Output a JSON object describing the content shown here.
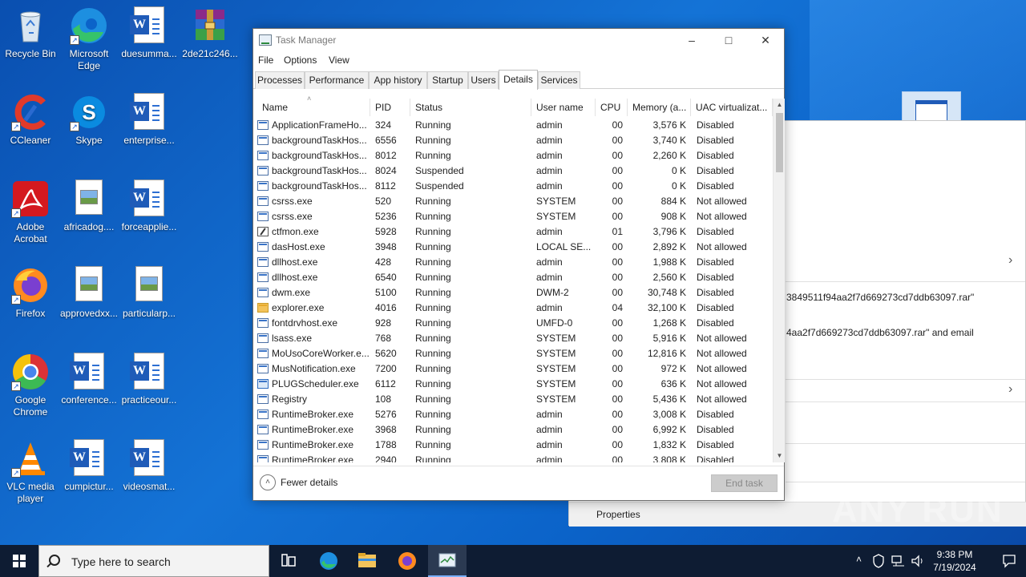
{
  "desktop": {
    "icons": [
      {
        "label": "Recycle Bin",
        "icon": "recycle-bin-icon"
      },
      {
        "label": "Microsoft Edge",
        "icon": "edge-icon"
      },
      {
        "label": "duesumma...",
        "icon": "word-doc-icon"
      },
      {
        "label": "2de21c246...",
        "icon": "winrar-archive-icon"
      },
      {
        "label": "CCleaner",
        "icon": "ccleaner-icon"
      },
      {
        "label": "Skype",
        "icon": "skype-icon"
      },
      {
        "label": "enterprise...",
        "icon": "word-doc-icon"
      },
      {
        "label": "Adobe Acrobat",
        "icon": "acrobat-icon"
      },
      {
        "label": "africadog....",
        "icon": "image-file-icon"
      },
      {
        "label": "forceapplie...",
        "icon": "word-doc-icon"
      },
      {
        "label": "Firefox",
        "icon": "firefox-icon"
      },
      {
        "label": "approvedxx...",
        "icon": "image-file-icon"
      },
      {
        "label": "particularp...",
        "icon": "image-file-icon"
      },
      {
        "label": "Google Chrome",
        "icon": "chrome-icon"
      },
      {
        "label": "conference...",
        "icon": "word-doc-icon"
      },
      {
        "label": "practiceour...",
        "icon": "word-doc-icon"
      },
      {
        "label": "VLC media player",
        "icon": "vlc-icon"
      },
      {
        "label": "cumpictur...",
        "icon": "word-doc-icon"
      },
      {
        "label": "videosmat...",
        "icon": "word-doc-icon"
      }
    ]
  },
  "task_manager": {
    "title": "Task Manager",
    "menu": [
      "File",
      "Options",
      "View"
    ],
    "tabs": [
      "Processes",
      "Performance",
      "App history",
      "Startup",
      "Users",
      "Details",
      "Services"
    ],
    "active_tab": "Details",
    "columns": [
      "Name",
      "PID",
      "Status",
      "User name",
      "CPU",
      "Memory (a...",
      "UAC virtualizat..."
    ],
    "rows": [
      {
        "name": "ApplicationFrameHo...",
        "pid": "324",
        "status": "Running",
        "user": "admin",
        "cpu": "00",
        "mem": "3,576 K",
        "uac": "Disabled",
        "icon": "app"
      },
      {
        "name": "backgroundTaskHos...",
        "pid": "6556",
        "status": "Running",
        "user": "admin",
        "cpu": "00",
        "mem": "3,740 K",
        "uac": "Disabled",
        "icon": "app"
      },
      {
        "name": "backgroundTaskHos...",
        "pid": "8012",
        "status": "Running",
        "user": "admin",
        "cpu": "00",
        "mem": "2,260 K",
        "uac": "Disabled",
        "icon": "app"
      },
      {
        "name": "backgroundTaskHos...",
        "pid": "8024",
        "status": "Suspended",
        "user": "admin",
        "cpu": "00",
        "mem": "0 K",
        "uac": "Disabled",
        "icon": "app"
      },
      {
        "name": "backgroundTaskHos...",
        "pid": "8112",
        "status": "Suspended",
        "user": "admin",
        "cpu": "00",
        "mem": "0 K",
        "uac": "Disabled",
        "icon": "app"
      },
      {
        "name": "csrss.exe",
        "pid": "520",
        "status": "Running",
        "user": "SYSTEM",
        "cpu": "00",
        "mem": "884 K",
        "uac": "Not allowed",
        "icon": "app"
      },
      {
        "name": "csrss.exe",
        "pid": "5236",
        "status": "Running",
        "user": "SYSTEM",
        "cpu": "00",
        "mem": "908 K",
        "uac": "Not allowed",
        "icon": "app"
      },
      {
        "name": "ctfmon.exe",
        "pid": "5928",
        "status": "Running",
        "user": "admin",
        "cpu": "01",
        "mem": "3,796 K",
        "uac": "Disabled",
        "icon": "pen"
      },
      {
        "name": "dasHost.exe",
        "pid": "3948",
        "status": "Running",
        "user": "LOCAL SE...",
        "cpu": "00",
        "mem": "2,892 K",
        "uac": "Not allowed",
        "icon": "app"
      },
      {
        "name": "dllhost.exe",
        "pid": "428",
        "status": "Running",
        "user": "admin",
        "cpu": "00",
        "mem": "1,988 K",
        "uac": "Disabled",
        "icon": "app"
      },
      {
        "name": "dllhost.exe",
        "pid": "6540",
        "status": "Running",
        "user": "admin",
        "cpu": "00",
        "mem": "2,560 K",
        "uac": "Disabled",
        "icon": "app"
      },
      {
        "name": "dwm.exe",
        "pid": "5100",
        "status": "Running",
        "user": "DWM-2",
        "cpu": "00",
        "mem": "30,748 K",
        "uac": "Disabled",
        "icon": "app"
      },
      {
        "name": "explorer.exe",
        "pid": "4016",
        "status": "Running",
        "user": "admin",
        "cpu": "04",
        "mem": "32,100 K",
        "uac": "Disabled",
        "icon": "folder"
      },
      {
        "name": "fontdrvhost.exe",
        "pid": "928",
        "status": "Running",
        "user": "UMFD-0",
        "cpu": "00",
        "mem": "1,268 K",
        "uac": "Disabled",
        "icon": "app"
      },
      {
        "name": "lsass.exe",
        "pid": "768",
        "status": "Running",
        "user": "SYSTEM",
        "cpu": "00",
        "mem": "5,916 K",
        "uac": "Not allowed",
        "icon": "app"
      },
      {
        "name": "MoUsoCoreWorker.e...",
        "pid": "5620",
        "status": "Running",
        "user": "SYSTEM",
        "cpu": "00",
        "mem": "12,816 K",
        "uac": "Not allowed",
        "icon": "app"
      },
      {
        "name": "MusNotification.exe",
        "pid": "7200",
        "status": "Running",
        "user": "SYSTEM",
        "cpu": "00",
        "mem": "972 K",
        "uac": "Not allowed",
        "icon": "app"
      },
      {
        "name": "PLUGScheduler.exe",
        "pid": "6112",
        "status": "Running",
        "user": "SYSTEM",
        "cpu": "00",
        "mem": "636 K",
        "uac": "Not allowed",
        "icon": "plug"
      },
      {
        "name": "Registry",
        "pid": "108",
        "status": "Running",
        "user": "SYSTEM",
        "cpu": "00",
        "mem": "5,436 K",
        "uac": "Not allowed",
        "icon": "app"
      },
      {
        "name": "RuntimeBroker.exe",
        "pid": "5276",
        "status": "Running",
        "user": "admin",
        "cpu": "00",
        "mem": "3,008 K",
        "uac": "Disabled",
        "icon": "app"
      },
      {
        "name": "RuntimeBroker.exe",
        "pid": "3968",
        "status": "Running",
        "user": "admin",
        "cpu": "00",
        "mem": "6,992 K",
        "uac": "Disabled",
        "icon": "app"
      },
      {
        "name": "RuntimeBroker.exe",
        "pid": "1788",
        "status": "Running",
        "user": "admin",
        "cpu": "00",
        "mem": "1,832 K",
        "uac": "Disabled",
        "icon": "app"
      },
      {
        "name": "RuntimeBroker.exe",
        "pid": "2940",
        "status": "Running",
        "user": "admin",
        "cpu": "00",
        "mem": "3,808 K",
        "uac": "Disabled",
        "icon": "app"
      }
    ],
    "footer": {
      "fewer_details": "Fewer details",
      "end_task": "End task"
    }
  },
  "background_window": {
    "line1": "3849511f94aa2f7d669273cd7ddb63097.rar\"",
    "line2": "4aa2f7d669273cd7ddb63097.rar\" and email",
    "properties": "Properties"
  },
  "watermark": "ANY RUN",
  "taskbar": {
    "search_placeholder": "Type here to search",
    "time": "9:38 PM",
    "date": "7/19/2024"
  }
}
